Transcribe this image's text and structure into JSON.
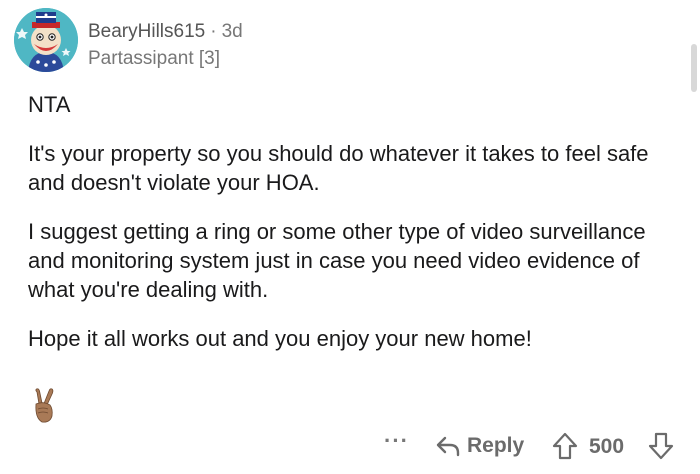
{
  "comment": {
    "author": "BearyHills615",
    "separator": "·",
    "age": "3d",
    "flair": "Partassipant [3]",
    "paragraphs": [
      "NTA",
      "It's your property so you should do whatever it takes to feel safe and doesn't violate your HOA.",
      "I suggest getting a ring or some other type of video surveillance and monitoring system just in case you need video evidence of what you're dealing with.",
      "Hope it all works out and you enjoy your new home!"
    ],
    "award_icon": "peace-hand-emoji"
  },
  "actions": {
    "more_label": "···",
    "reply_label": "Reply",
    "score": "500",
    "upvote_icon": "arrow-up-icon",
    "downvote_icon": "arrow-down-icon",
    "reply_icon": "reply-arrow-icon"
  },
  "colors": {
    "avatar_bg": "#4fb7c4",
    "meta_text": "#777777",
    "body_text": "#1a1a1b"
  }
}
